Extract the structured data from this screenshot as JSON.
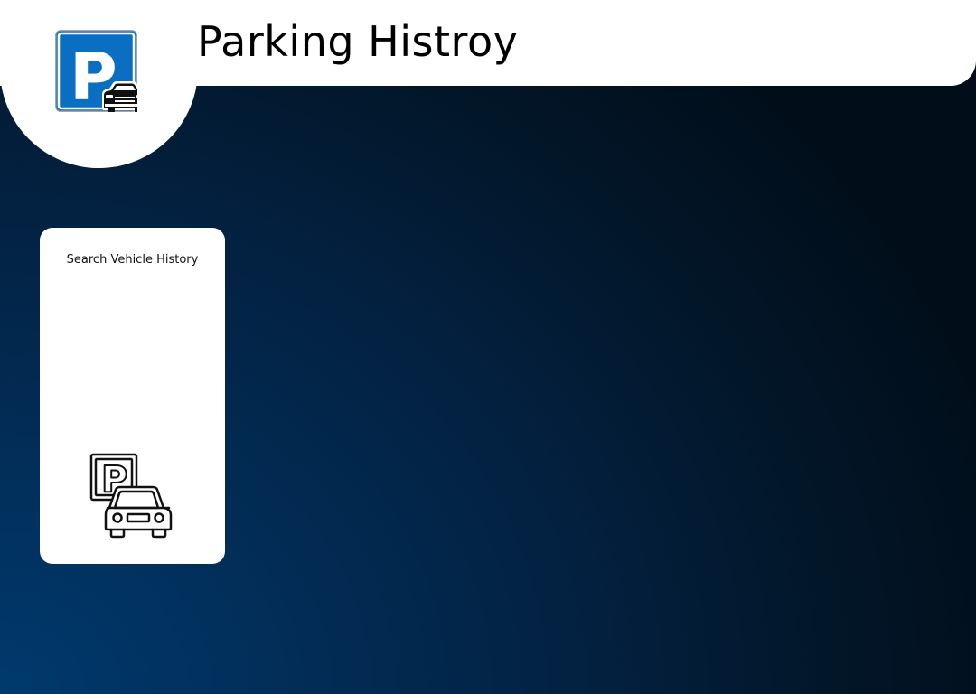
{
  "header": {
    "title": "Parking Histroy",
    "logo_icon": "parking-sign-car-icon",
    "logo_letter": "P",
    "colors": {
      "bar": "#ffffff",
      "sign_blue": "#0a6fc2",
      "title_text": "#000000"
    }
  },
  "main": {
    "background_colors": [
      "#003a6e",
      "#021629",
      "#010e1a"
    ],
    "cards": [
      {
        "label": "Search Vehicle History",
        "icon": "parking-car-outline-icon",
        "icon_letter": "P"
      }
    ]
  }
}
